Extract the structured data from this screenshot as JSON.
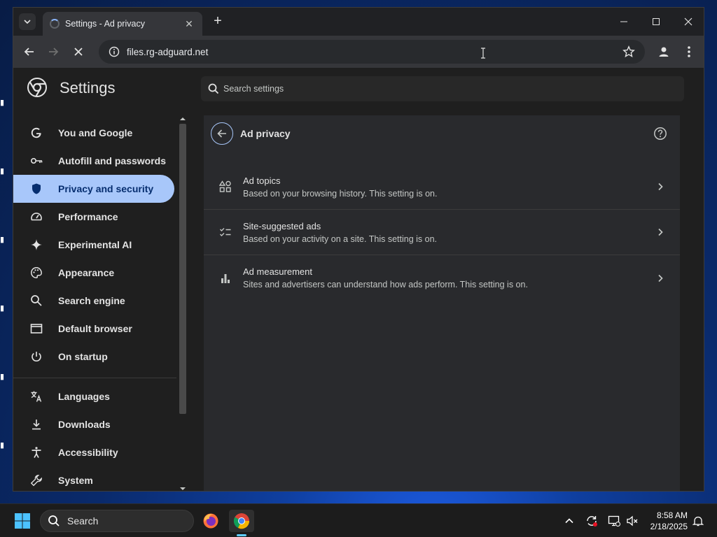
{
  "browser": {
    "tab_title": "Settings - Ad privacy",
    "url": "files.rg-adguard.net"
  },
  "settings": {
    "title": "Settings",
    "search_placeholder": "Search settings",
    "nav": [
      {
        "label": "You and Google",
        "icon": "google-g-icon"
      },
      {
        "label": "Autofill and passwords",
        "icon": "key-icon"
      },
      {
        "label": "Privacy and security",
        "icon": "shield-icon"
      },
      {
        "label": "Performance",
        "icon": "speedometer-icon"
      },
      {
        "label": "Experimental AI",
        "icon": "sparkle-icon"
      },
      {
        "label": "Appearance",
        "icon": "palette-icon"
      },
      {
        "label": "Search engine",
        "icon": "search-icon"
      },
      {
        "label": "Default browser",
        "icon": "browser-window-icon"
      },
      {
        "label": "On startup",
        "icon": "power-icon"
      },
      {
        "label": "Languages",
        "icon": "translate-icon"
      },
      {
        "label": "Downloads",
        "icon": "download-icon"
      },
      {
        "label": "Accessibility",
        "icon": "accessibility-icon"
      },
      {
        "label": "System",
        "icon": "wrench-icon"
      }
    ],
    "active_nav": "Privacy and security"
  },
  "ad_privacy": {
    "title": "Ad privacy",
    "rows": [
      {
        "title": "Ad topics",
        "subtitle": "Based on your browsing history. This setting is on.",
        "icon": "topics-icon"
      },
      {
        "title": "Site-suggested ads",
        "subtitle": "Based on your activity on a site. This setting is on.",
        "icon": "checklist-icon"
      },
      {
        "title": "Ad measurement",
        "subtitle": "Sites and advertisers can understand how ads perform. This setting is on.",
        "icon": "bar-chart-icon"
      }
    ]
  },
  "taskbar": {
    "search_label": "Search",
    "time": "8:58 AM",
    "date": "2/18/2025"
  },
  "colors": {
    "accent": "#a8c7fa",
    "active_text": "#062e6f",
    "page_bg": "#1f1f1f",
    "card_bg": "#292a2d"
  }
}
